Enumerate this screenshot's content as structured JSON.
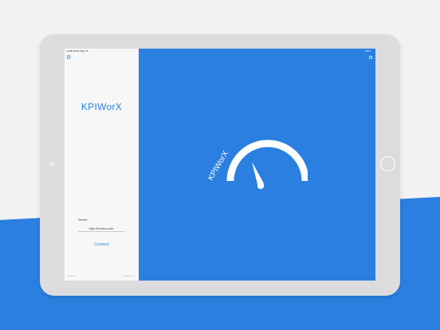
{
  "colors": {
    "brand_blue": "#2a7fe0",
    "bezel": "#dcdcdf",
    "sidebar": "#f7f7f8",
    "background_top": "#f2f2f3"
  },
  "status_bar": {
    "time": "11:08 AM   Fri May 27",
    "right": "100%"
  },
  "sidebar": {
    "settings_icon": "gear-icon",
    "app_title": "KPIWorX",
    "server_label": "Server",
    "server_value": "http://iconics.com",
    "connect_label": "Connect",
    "footer_left": "KPIWorX",
    "footer_right": "ICONICS Inc."
  },
  "main": {
    "more_icon": "square-icon",
    "logo_text": "KPIWorX",
    "logo_icon": "gauge-icon"
  }
}
